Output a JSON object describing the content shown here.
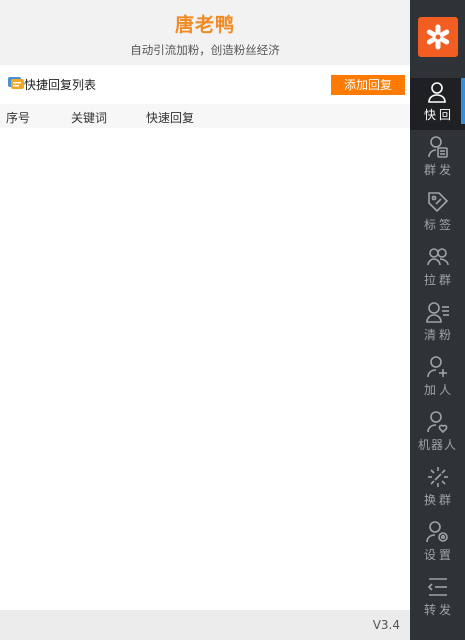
{
  "header": {
    "title": "唐老鸭",
    "subtitle": "自动引流加粉，创造粉丝经济"
  },
  "toolbar": {
    "list_title": "快捷回复列表",
    "add_button": "添加回复"
  },
  "table": {
    "columns": [
      "序号",
      "关键词",
      "快速回复"
    ],
    "rows": []
  },
  "footer": {
    "version": "V3.4"
  },
  "sidebar": {
    "items": [
      {
        "label": "快回",
        "icon": "quick-reply-icon",
        "active": true
      },
      {
        "label": "群发",
        "icon": "mass-send-icon",
        "active": false
      },
      {
        "label": "标签",
        "icon": "tag-icon",
        "active": false
      },
      {
        "label": "拉群",
        "icon": "pull-group-icon",
        "active": false
      },
      {
        "label": "清粉",
        "icon": "clear-fans-icon",
        "active": false
      },
      {
        "label": "加人",
        "icon": "add-person-icon",
        "active": false
      },
      {
        "label": "机器人",
        "icon": "robot-icon",
        "active": false
      },
      {
        "label": "换群",
        "icon": "switch-group-icon",
        "active": false
      },
      {
        "label": "设置",
        "icon": "settings-icon",
        "active": false
      },
      {
        "label": "转发",
        "icon": "forward-icon",
        "active": false
      }
    ]
  },
  "colors": {
    "accent": "#ff7a00",
    "title": "#f08a24",
    "sidebar_bg": "#2f3236",
    "active_indicator": "#3a8fd9",
    "logo_bg": "#f25d22"
  }
}
